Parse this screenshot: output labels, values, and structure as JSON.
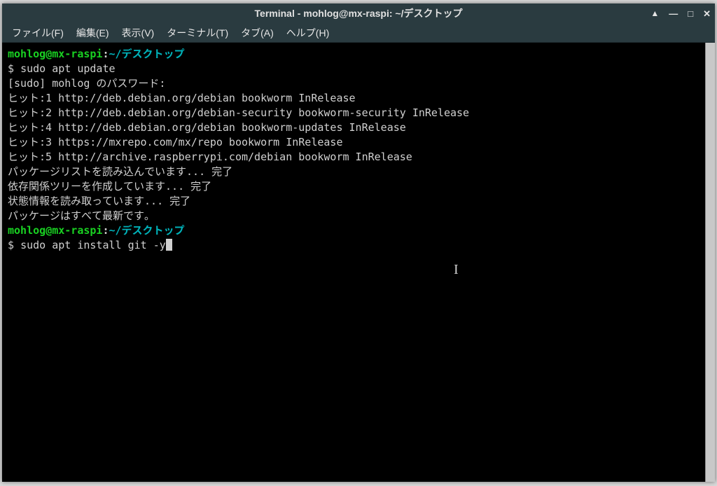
{
  "titlebar": {
    "title": "Terminal - mohlog@mx-raspi: ~/デスクトップ"
  },
  "menu": {
    "file": "ファイル(F)",
    "edit": "編集(E)",
    "view": "表示(V)",
    "terminal": "ターミナル(T)",
    "tabs": "タブ(A)",
    "help": "ヘルプ(H)"
  },
  "prompt1": {
    "user": "mohlog",
    "at": "@",
    "host": "mx-raspi",
    "colon": ":",
    "path": "~/デスクトップ"
  },
  "cmd1": {
    "ps": "$ ",
    "text": "sudo apt update"
  },
  "out": {
    "l1": "[sudo] mohlog のパスワード:",
    "l2": "ヒット:1 http://deb.debian.org/debian bookworm InRelease",
    "l3": "ヒット:2 http://deb.debian.org/debian-security bookworm-security InRelease",
    "l4": "ヒット:4 http://deb.debian.org/debian bookworm-updates InRelease",
    "l5": "ヒット:3 https://mxrepo.com/mx/repo bookworm InRelease",
    "l6": "ヒット:5 http://archive.raspberrypi.com/debian bookworm InRelease",
    "l7": "パッケージリストを読み込んでいます... 完了",
    "l8": "依存関係ツリーを作成しています... 完了",
    "l9": "状態情報を読み取っています... 完了",
    "l10": "パッケージはすべて最新です。"
  },
  "prompt2": {
    "user": "mohlog",
    "at": "@",
    "host": "mx-raspi",
    "colon": ":",
    "path": "~/デスクトップ"
  },
  "cmd2": {
    "ps": "$ ",
    "text": "sudo apt install git -y"
  },
  "ibeam_glyph": "I"
}
